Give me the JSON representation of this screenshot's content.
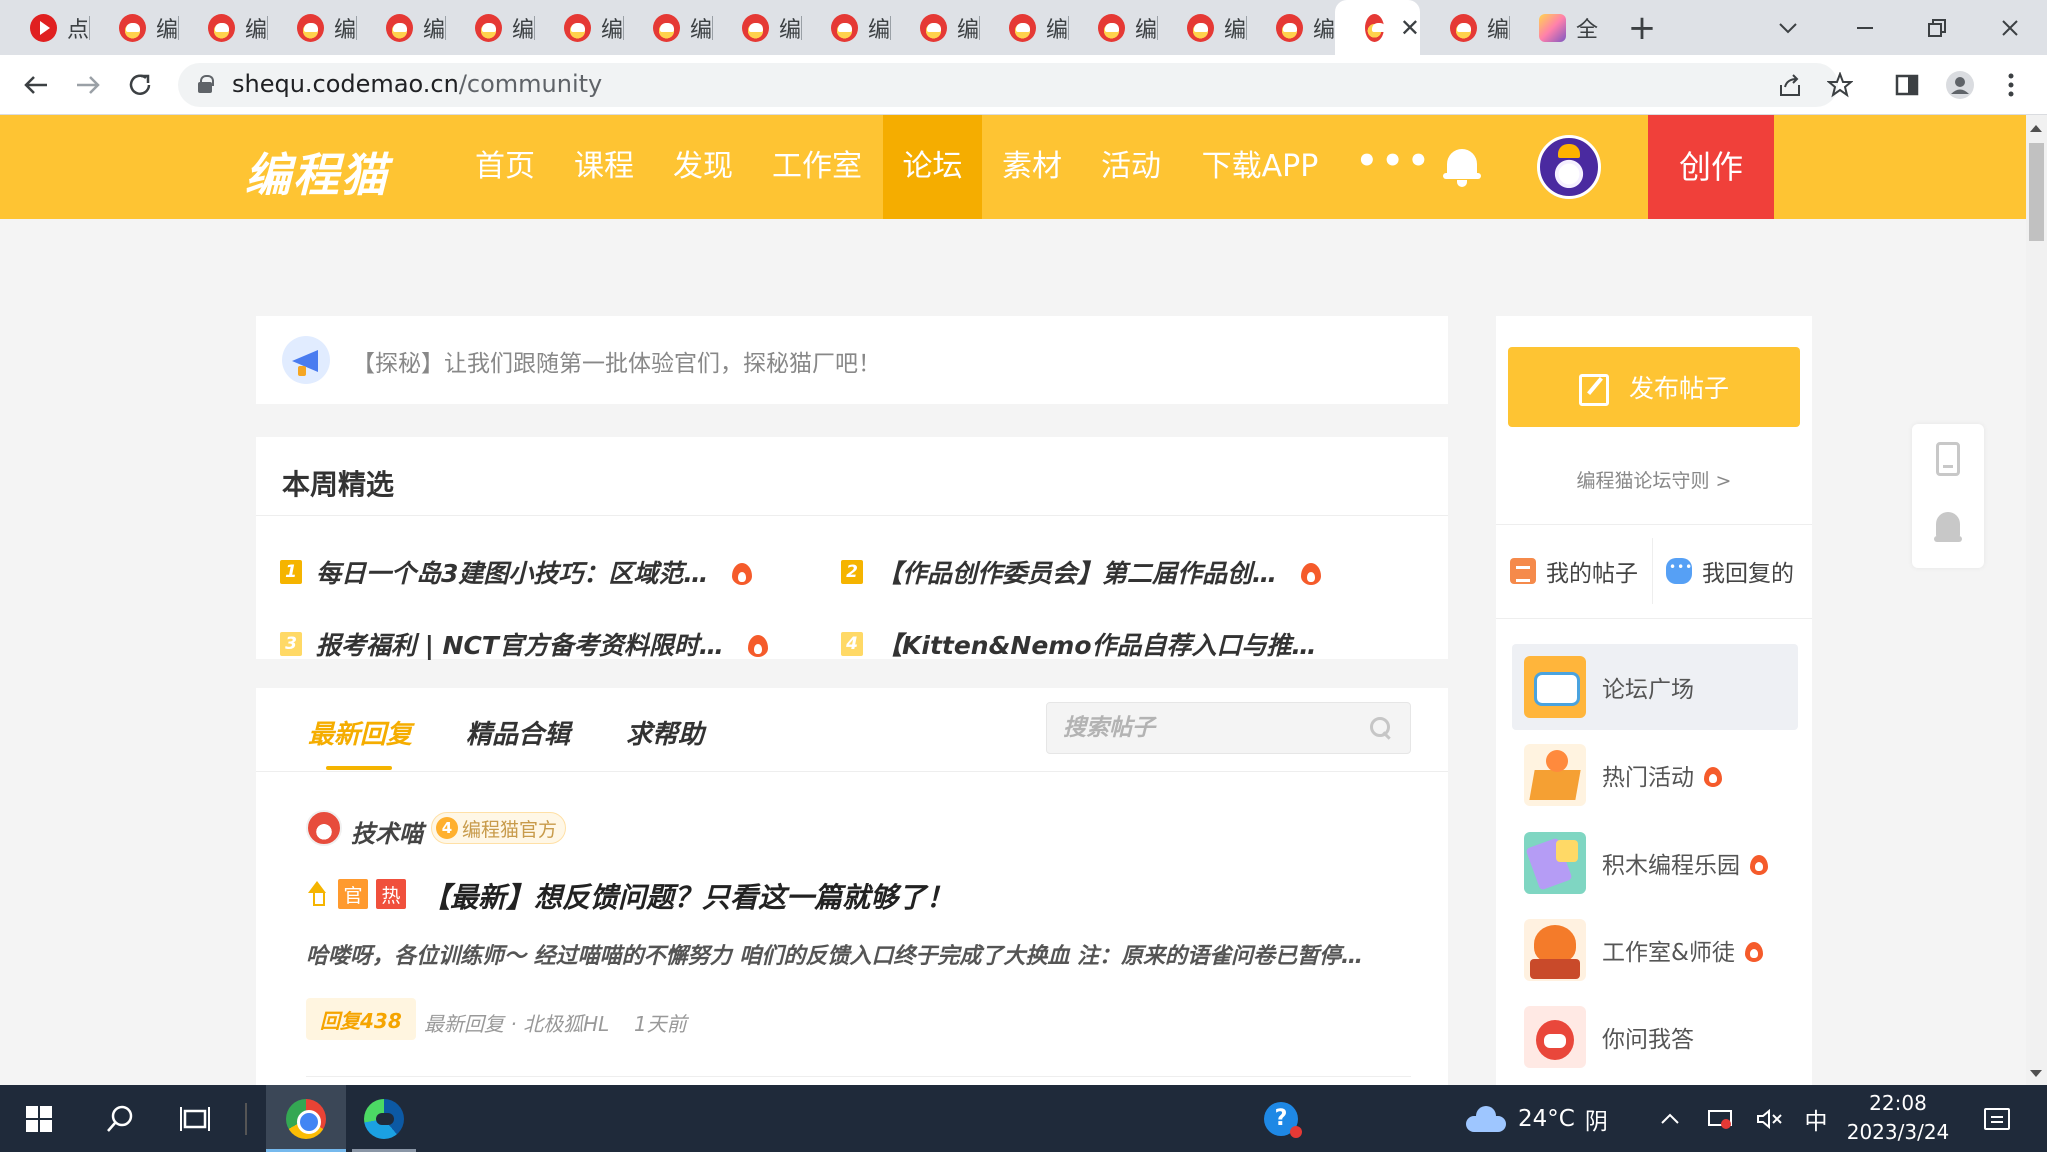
{
  "browser": {
    "tabs": [
      {
        "title": "点"
      },
      {
        "title": "编"
      },
      {
        "title": "编"
      },
      {
        "title": "编"
      },
      {
        "title": "编"
      },
      {
        "title": "编"
      },
      {
        "title": "编"
      },
      {
        "title": "编"
      },
      {
        "title": "编"
      },
      {
        "title": "编"
      },
      {
        "title": "编"
      },
      {
        "title": "编"
      },
      {
        "title": "编"
      },
      {
        "title": "编"
      },
      {
        "title": "编"
      },
      {
        "title": ""
      },
      {
        "title": "编"
      },
      {
        "title": "全"
      }
    ],
    "close_tab_glyph": "✕",
    "new_tab_glyph": "+",
    "url_host": "shequ.codemao.cn",
    "url_path": "/community"
  },
  "site": {
    "logo": "编程猫",
    "nav": [
      "首页",
      "课程",
      "发现",
      "工作室",
      "论坛",
      "素材",
      "活动",
      "下载APP"
    ],
    "nav_active_index": 4,
    "nav_more": "•••",
    "create_label": "创作"
  },
  "notice": {
    "text": "【探秘】让我们跟随第一批体验官们，探秘猫厂吧！"
  },
  "weekly": {
    "title": "本周精选",
    "items": [
      {
        "num": "1",
        "text": "每日一个岛3建图小技巧：区域范…",
        "hot": true
      },
      {
        "num": "2",
        "text": "【作品创作委员会】第二届作品创…",
        "hot": true
      },
      {
        "num": "3",
        "text": "报考福利 | NCT官方备考资料限时…",
        "hot": true
      },
      {
        "num": "4",
        "text": "【Kitten&Nemo作品自荐入口与推…",
        "hot": false
      }
    ]
  },
  "forum": {
    "tabs": [
      "最新回复",
      "精品合辑",
      "求帮助"
    ],
    "active_tab_index": 0,
    "search_placeholder": "搜索帖子",
    "post": {
      "author": "技术喵",
      "level": "4",
      "badge": "编程猫官方",
      "flag_official": "官",
      "flag_hot": "热",
      "title": "【最新】想反馈问题？只看这一篇就够了！",
      "excerpt": "哈喽呀，各位训练师～ 经过喵喵的不懈努力 咱们的反馈入口终于完成了大换血  注：原来的语雀问卷已暂停…",
      "reply_count": "回复438",
      "last_reply": "最新回复 · 北极狐HL",
      "time": "1天前"
    }
  },
  "sidebar": {
    "publish_label": "发布帖子",
    "rules_link": "编程猫论坛守则 >",
    "my_posts": "我的帖子",
    "my_replies": "我回复的",
    "items": [
      {
        "label": "论坛广场",
        "hot": false
      },
      {
        "label": "热门活动",
        "hot": true
      },
      {
        "label": "积木编程乐园",
        "hot": true
      },
      {
        "label": "工作室&师徒",
        "hot": true
      },
      {
        "label": "你问我答",
        "hot": false
      }
    ]
  },
  "taskbar": {
    "weather_temp": "24°C",
    "weather_desc": "阴",
    "ime": "中",
    "time": "22:08",
    "date": "2023/3/24"
  }
}
